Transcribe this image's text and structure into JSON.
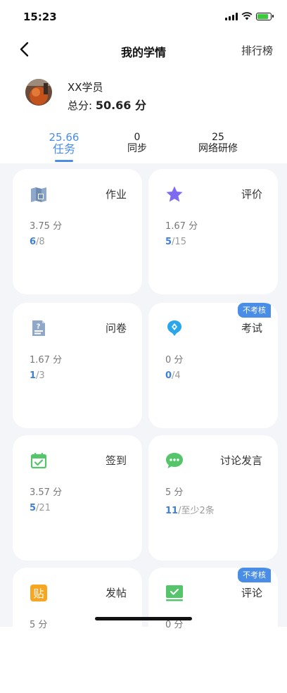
{
  "status_bar": {
    "time": "15:23"
  },
  "nav": {
    "title": "我的学情",
    "right_action": "排行榜"
  },
  "profile": {
    "name": "XX学员",
    "total_label": "总分: ",
    "total_value": "50.66 分"
  },
  "tabs": [
    {
      "value": "25.66",
      "label": "任务",
      "active": true
    },
    {
      "value": "0",
      "label": "同步",
      "active": false
    },
    {
      "value": "25",
      "label": "网络研修",
      "active": false
    }
  ],
  "cards": [
    {
      "title": "作业",
      "points": "3.75 分",
      "done": "6",
      "rest": "/8",
      "badge": "",
      "icon": "homework-icon"
    },
    {
      "title": "评价",
      "points": "1.67 分",
      "done": "5",
      "rest": "/15",
      "badge": "",
      "icon": "star-icon"
    },
    {
      "title": "问卷",
      "points": "1.67 分",
      "done": "1",
      "rest": "/3",
      "badge": "",
      "icon": "questionnaire-icon"
    },
    {
      "title": "考试",
      "points": "0 分",
      "done": "0",
      "rest": "/4",
      "badge": "不考核",
      "icon": "exam-pen-icon"
    },
    {
      "title": "签到",
      "points": "3.57 分",
      "done": "5",
      "rest": "/21",
      "badge": "",
      "icon": "calendar-check-icon"
    },
    {
      "title": "讨论发言",
      "points": "5 分",
      "done": "11",
      "rest": "/至少2条",
      "badge": "",
      "icon": "chat-bubble-icon"
    },
    {
      "title": "发帖",
      "points": "5 分",
      "done": "",
      "rest": "",
      "badge": "",
      "icon": "post-icon"
    },
    {
      "title": "评论",
      "points": "0 分",
      "done": "",
      "rest": "",
      "badge": "不考核",
      "icon": "comment-check-icon"
    }
  ],
  "icons": {
    "post_glyph": "贴"
  },
  "colors": {
    "accent": "#4a8de6",
    "star": "#7e6bf0",
    "green": "#54c56b",
    "orange": "#f5a623"
  }
}
